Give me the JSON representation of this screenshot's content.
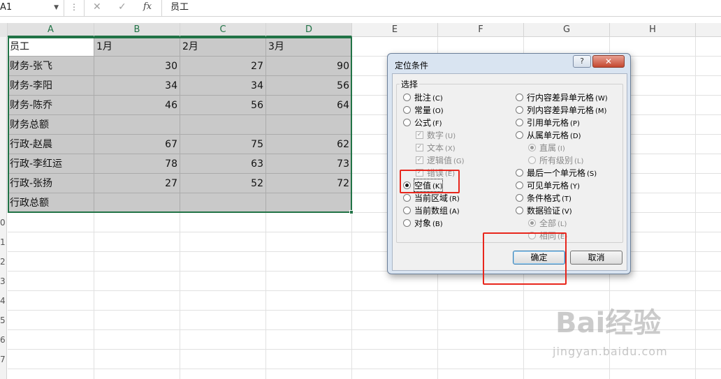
{
  "formula_bar": {
    "name_box": "A1",
    "cancel": "✕",
    "enter": "✓",
    "fx": "fx",
    "content": "员工"
  },
  "columns": [
    "A",
    "B",
    "C",
    "D",
    "E",
    "F",
    "G",
    "H"
  ],
  "row_numbers": [
    "",
    "",
    "",
    "",
    "",
    "",
    "",
    "",
    "",
    "0",
    "1",
    "2",
    "3",
    "4",
    "5",
    "6",
    "7"
  ],
  "table": {
    "headers": [
      "员工",
      "1月",
      "2月",
      "3月"
    ],
    "rows": [
      [
        "财务-张飞",
        "30",
        "27",
        "90"
      ],
      [
        "财务-李阳",
        "34",
        "34",
        "56"
      ],
      [
        "财务-陈乔",
        "46",
        "56",
        "64"
      ],
      [
        "财务总额",
        "",
        "",
        ""
      ],
      [
        "行政-赵晨",
        "67",
        "75",
        "62"
      ],
      [
        "行政-李红运",
        "78",
        "63",
        "73"
      ],
      [
        "行政-张扬",
        "27",
        "52",
        "72"
      ],
      [
        "行政总额",
        "",
        "",
        ""
      ]
    ]
  },
  "dialog": {
    "title": "定位条件",
    "help": "?",
    "close": "✕",
    "group_label": "选择",
    "left_options": [
      {
        "label": "批注",
        "key": "(C)",
        "selected": false,
        "disabled": false,
        "kind": "radio"
      },
      {
        "label": "常量",
        "key": "(O)",
        "selected": false,
        "disabled": false,
        "kind": "radio"
      },
      {
        "label": "公式",
        "key": "(F)",
        "selected": false,
        "disabled": false,
        "kind": "radio"
      },
      {
        "label": "数字",
        "key": "(U)",
        "selected": true,
        "disabled": true,
        "kind": "check"
      },
      {
        "label": "文本",
        "key": "(X)",
        "selected": true,
        "disabled": true,
        "kind": "check"
      },
      {
        "label": "逻辑值",
        "key": "(G)",
        "selected": true,
        "disabled": true,
        "kind": "check"
      },
      {
        "label": "错误",
        "key": "(E)",
        "selected": true,
        "disabled": true,
        "kind": "check"
      },
      {
        "label": "空值",
        "key": "(K)",
        "selected": true,
        "disabled": false,
        "kind": "radio"
      },
      {
        "label": "当前区域",
        "key": "(R)",
        "selected": false,
        "disabled": false,
        "kind": "radio"
      },
      {
        "label": "当前数组",
        "key": "(A)",
        "selected": false,
        "disabled": false,
        "kind": "radio"
      },
      {
        "label": "对象",
        "key": "(B)",
        "selected": false,
        "disabled": false,
        "kind": "radio"
      }
    ],
    "right_options": [
      {
        "label": "行内容差异单元格",
        "key": "(W)",
        "selected": false,
        "disabled": false
      },
      {
        "label": "列内容差异单元格",
        "key": "(M)",
        "selected": false,
        "disabled": false
      },
      {
        "label": "引用单元格",
        "key": "(P)",
        "selected": false,
        "disabled": false
      },
      {
        "label": "从属单元格",
        "key": "(D)",
        "selected": false,
        "disabled": false
      },
      {
        "label": "直属",
        "key": "(I)",
        "selected": true,
        "disabled": true
      },
      {
        "label": "所有级别",
        "key": "(L)",
        "selected": false,
        "disabled": true
      },
      {
        "label": "最后一个单元格",
        "key": "(S)",
        "selected": false,
        "disabled": false
      },
      {
        "label": "可见单元格",
        "key": "(Y)",
        "selected": false,
        "disabled": false
      },
      {
        "label": "条件格式",
        "key": "(T)",
        "selected": false,
        "disabled": false
      },
      {
        "label": "数据验证",
        "key": "(V)",
        "selected": false,
        "disabled": false
      },
      {
        "label": "全部",
        "key": "(L)",
        "selected": true,
        "disabled": true
      },
      {
        "label": "相同",
        "key": "(E)",
        "selected": false,
        "disabled": true
      }
    ],
    "ok": "确定",
    "cancel": "取消"
  },
  "watermark": {
    "logo": "Bai经验",
    "url": "jingyan.baidu.com"
  },
  "colors": {
    "selection": "#217346",
    "highlight_box": "#e8261c",
    "data_fill": "#c9c9c9"
  }
}
